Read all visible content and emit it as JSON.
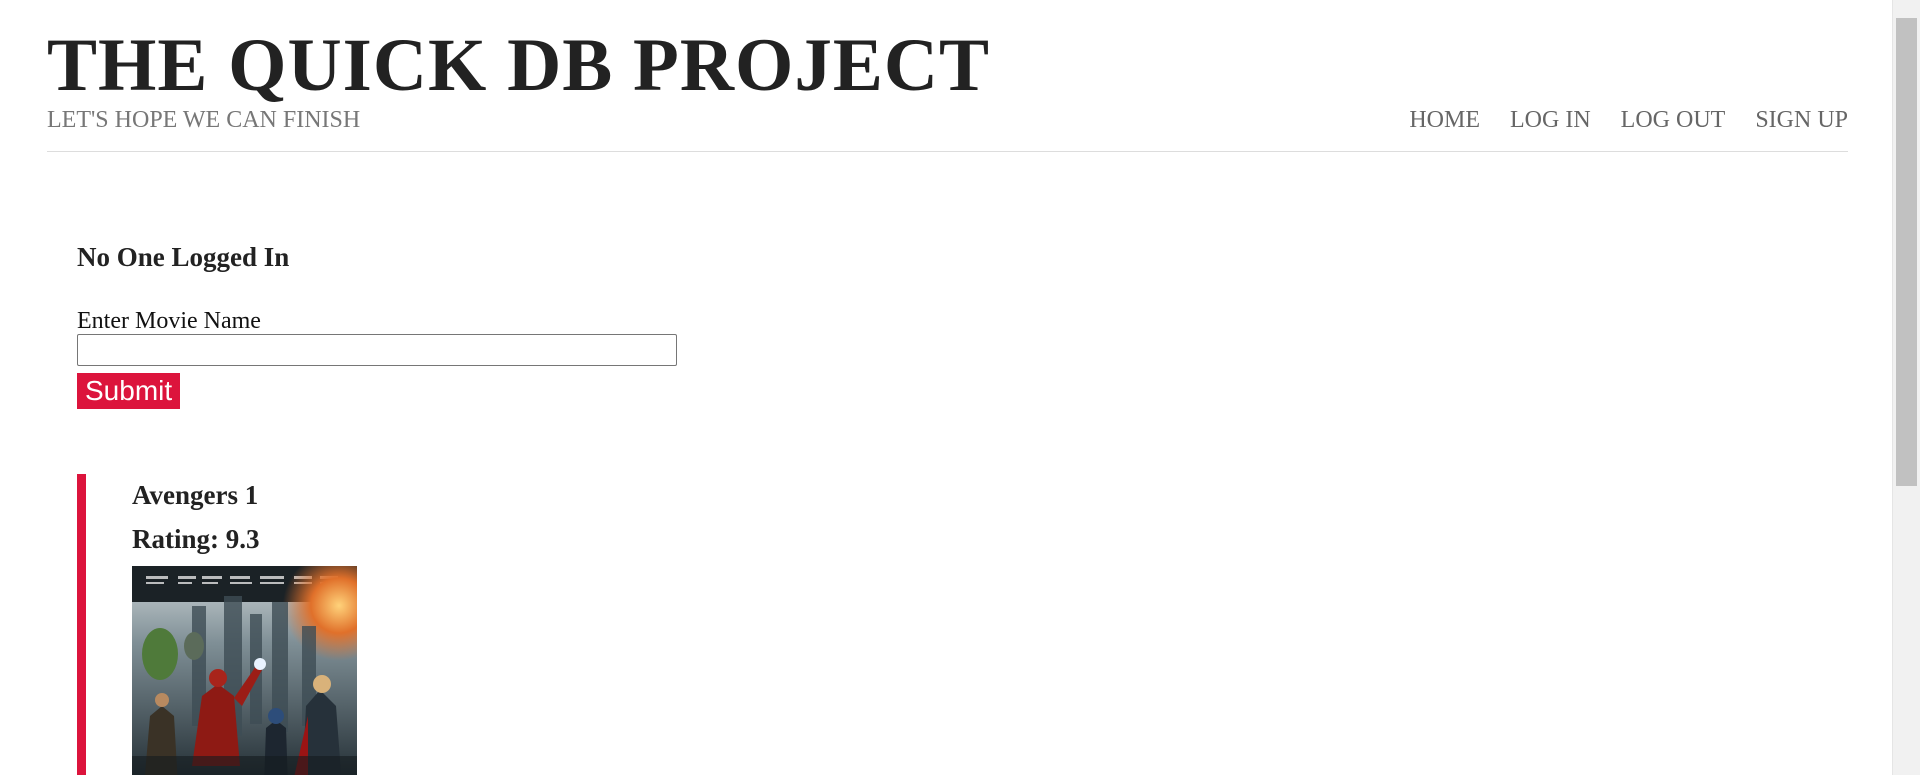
{
  "header": {
    "title": "THE QUICK DB PROJECT",
    "subtitle": "LET'S HOPE WE CAN FINISH",
    "nav": [
      {
        "label": "HOME"
      },
      {
        "label": "LOG IN"
      },
      {
        "label": "LOG OUT"
      },
      {
        "label": "SIGN UP"
      }
    ]
  },
  "status": {
    "text": "No One Logged In"
  },
  "search": {
    "label": "Enter Movie Name",
    "value": "",
    "submit_label": "Submit"
  },
  "movie": {
    "name": "Avengers 1",
    "rating_text": "Rating: 9.3",
    "poster_icon": "movie-poster-image"
  },
  "colors": {
    "accent": "#dc143c",
    "title": "#222222",
    "nav": "#666666",
    "subtitle": "#777777"
  }
}
